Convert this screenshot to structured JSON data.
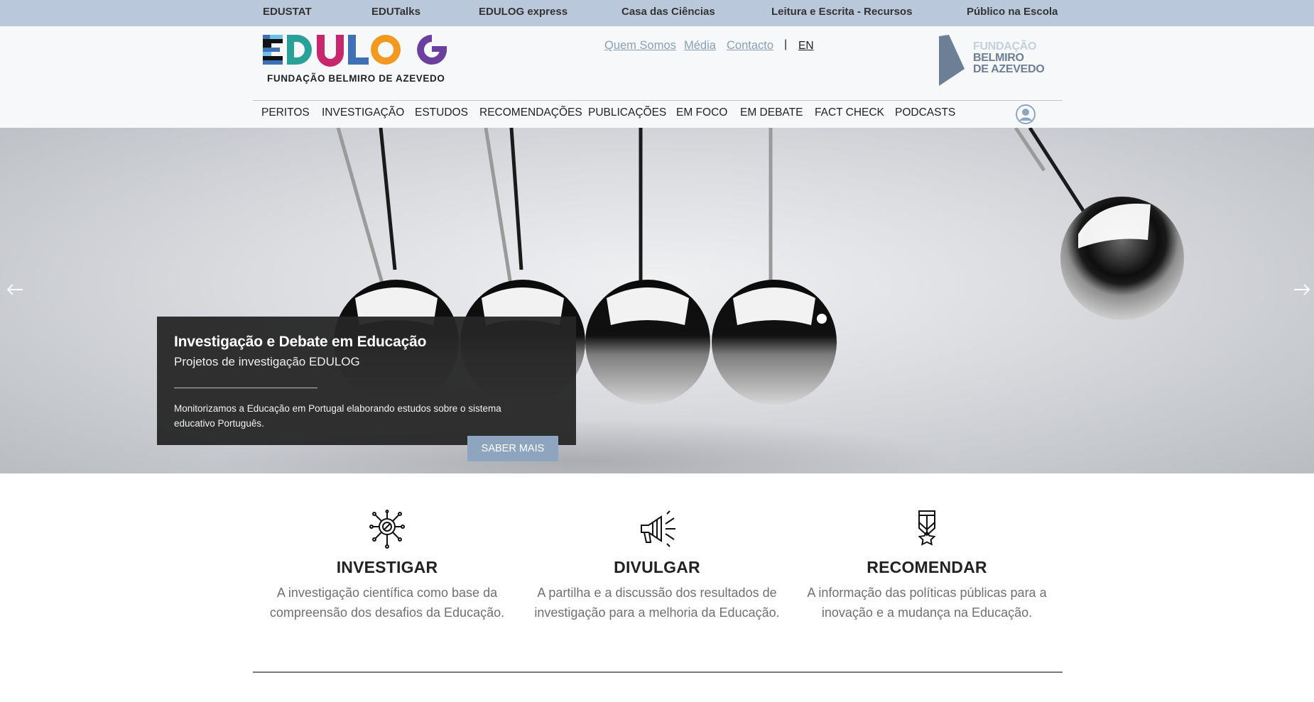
{
  "topbar": {
    "links": [
      "EDUSTAT",
      "EDUTalks",
      "EDULOG express",
      "Casa das Ciências",
      "Leitura e Escrita - Recursos",
      "Público na Escola"
    ]
  },
  "header": {
    "logo_text": "EDULOG",
    "logo_subtitle": "FUNDAÇÃO BELMIRO DE AZEVEDO",
    "secondary_nav": [
      "Quem Somos",
      "Média",
      "Contacto"
    ],
    "separator": "|",
    "language": "EN",
    "foundation_logo": {
      "line1": "FUNDAÇÃO",
      "line2": "BELMIRO",
      "line3": "DE AZEVEDO"
    },
    "colors": {
      "brand_blue": "#3f6fb5",
      "brand_teal": "#2aa198",
      "brand_pink": "#c8266d",
      "brand_orange": "#f29a1f",
      "brand_purple": "#6a3fa0"
    }
  },
  "main_nav": [
    "PERITOS",
    "INVESTIGAÇÃO",
    "ESTUDOS",
    "RECOMENDAÇÕES",
    "PUBLICAÇÕES",
    "EM FOCO",
    "EM DEBATE",
    "FACT CHECK",
    "PODCASTS"
  ],
  "user_icon": "user-circle-icon",
  "hero": {
    "title": "Investigação e Debate em Educação",
    "subtitle": "Projetos de investigação EDULOG",
    "text": "Monitorizamos a Educação em Portugal elaborando estudos sobre o sistema educativo Português.",
    "button": "SABER MAIS",
    "prev_icon": "arrow-left-icon",
    "next_icon": "arrow-right-icon"
  },
  "features": [
    {
      "icon": "research-magnifier-icon",
      "title": "INVESTIGAR",
      "text": "A investigação científica como base da compreensão dos desafios da Educação."
    },
    {
      "icon": "megaphone-icon",
      "title": "DIVULGAR",
      "text": "A partilha e a discussão dos resultados de investigação para a melhoria da Educação."
    },
    {
      "icon": "medal-star-icon",
      "title": "RECOMENDAR",
      "text": "A informação das políticas públicas para a inovação e a mudança na Educação."
    }
  ]
}
